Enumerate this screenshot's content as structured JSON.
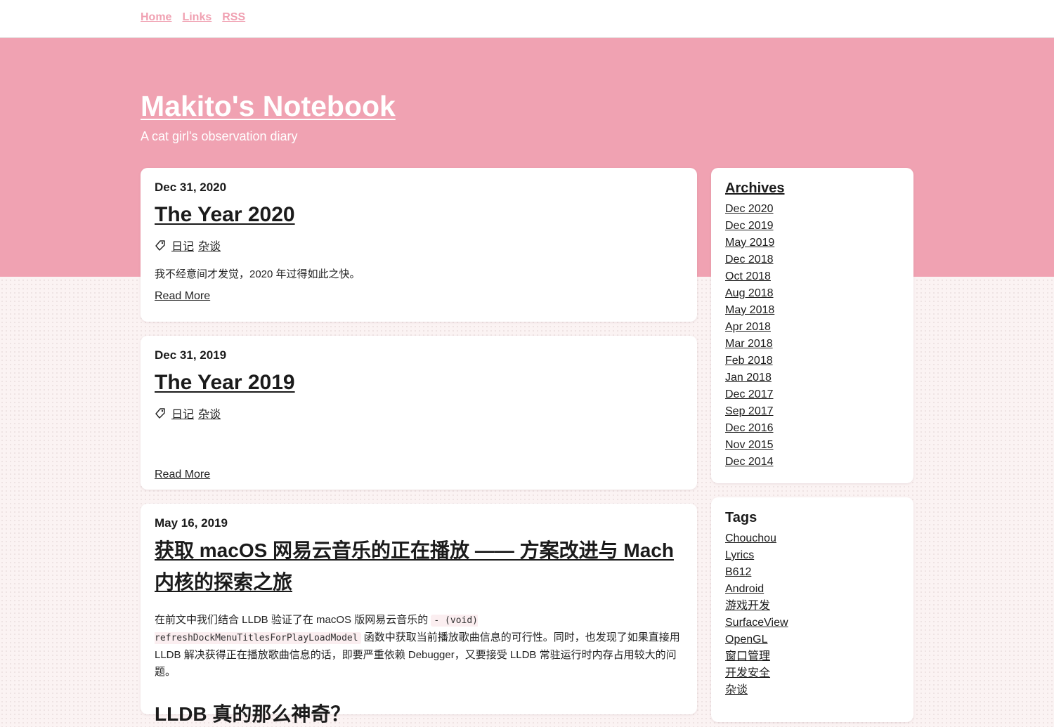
{
  "nav": {
    "items": [
      "Home",
      "Links",
      "RSS"
    ]
  },
  "site": {
    "title": "Makito's Notebook",
    "subtitle": "A cat girl's observation diary"
  },
  "posts": [
    {
      "date": "Dec 31, 2020",
      "title": "The Year 2020",
      "tags": [
        "日记",
        "杂谈"
      ],
      "excerpt": "我不经意间才发觉，2020 年过得如此之快。",
      "read_more": "Read More"
    },
    {
      "date": "Dec 31, 2019",
      "title": "The Year 2019",
      "tags": [
        "日记",
        "杂谈"
      ],
      "excerpt": "",
      "read_more": "Read More"
    },
    {
      "date": "May 16, 2019",
      "title": "获取 macOS 网易云音乐的正在播放 —— 方案改进与 Mach 内核的探索之旅",
      "excerpt_before": "在前文中我们结合 LLDB 验证了在 macOS 版网易云音乐的",
      "excerpt_code": "- (void) refreshDockMenuTitlesForPlayLoadModel",
      "excerpt_after": "函数中获取当前播放歌曲信息的可行性。同时，也发现了如果直接用 LLDB 解决获得正在播放歌曲信息的话，即要严重依赖 Debugger，又要接受 LLDB 常驻运行时内存占用较大的问题。",
      "section_heading": "LLDB 真的那么神奇？"
    }
  ],
  "sidebar": {
    "archives_title": "Archives",
    "archives": [
      "Dec 2020",
      "Dec 2019",
      "May 2019",
      "Dec 2018",
      "Oct 2018",
      "Aug 2018",
      "May 2018",
      "Apr 2018",
      "Mar 2018",
      "Feb 2018",
      "Jan 2018",
      "Dec 2017",
      "Sep 2017",
      "Dec 2016",
      "Nov 2015",
      "Dec 2014"
    ],
    "tags_title": "Tags",
    "tags": [
      "Chouchou",
      "Lyrics",
      "B612",
      "Android",
      "游戏开发",
      "SurfaceView",
      "OpenGL",
      "窗口管理",
      "开发安全",
      "杂谈"
    ]
  },
  "colors": {
    "accent": "#f0a2b2",
    "nav_link": "#f0a1b2",
    "text": "#1b1b1b",
    "background": "#fbf3f3"
  }
}
